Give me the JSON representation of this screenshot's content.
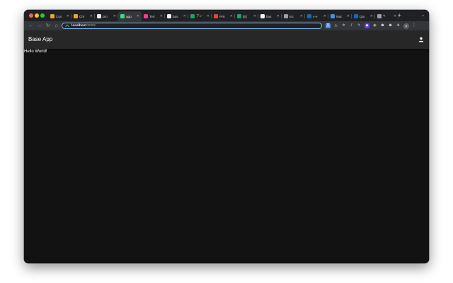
{
  "browser": {
    "tabs": [
      {
        "label": "Con",
        "favicon": "chrome-icon",
        "color": "#e8a33d"
      },
      {
        "label": "Chr",
        "favicon": "chrome-icon",
        "color": "#e8a33d"
      },
      {
        "label": "pro",
        "favicon": "github-icon",
        "color": "#f0f0f0"
      },
      {
        "label": "app",
        "favicon": "app-icon",
        "color": "#3ddc84",
        "active": true
      },
      {
        "label": "Terr",
        "favicon": "terraform-icon",
        "color": "#e84393"
      },
      {
        "label": "bas",
        "favicon": "github-icon",
        "color": "#f0f0f0"
      },
      {
        "label": "アン",
        "favicon": "sheets-icon",
        "color": "#1ea362"
      },
      {
        "label": "PRI",
        "favicon": "gmail-icon",
        "color": "#ea4335"
      },
      {
        "label": "[B]",
        "favicon": "sheets-icon",
        "color": "#1ea362"
      },
      {
        "label": "bas",
        "favicon": "github-icon",
        "color": "#f0f0f0"
      },
      {
        "label": "loc",
        "favicon": "globe-icon",
        "color": "#9aa0a6"
      },
      {
        "label": "v-e",
        "favicon": "vuetify-icon",
        "color": "#1867c0"
      },
      {
        "label": "Mat",
        "favicon": "material-icon",
        "color": "#4a90e2"
      },
      {
        "label": "Qui",
        "favicon": "vuetify-icon",
        "color": "#1867c0"
      },
      {
        "label": "✎",
        "favicon": "loading-icon",
        "color": "#9aa0a6"
      }
    ],
    "new_tab_symbol": "+",
    "tab_menu_symbol": "⌄",
    "address": {
      "host": "localhost",
      "port": ":8000/"
    },
    "nav": {
      "back": "←",
      "forward": "→",
      "reload": "↻",
      "home": "⌂"
    }
  },
  "app": {
    "title": "Base App",
    "body_text": "Hello World!"
  }
}
